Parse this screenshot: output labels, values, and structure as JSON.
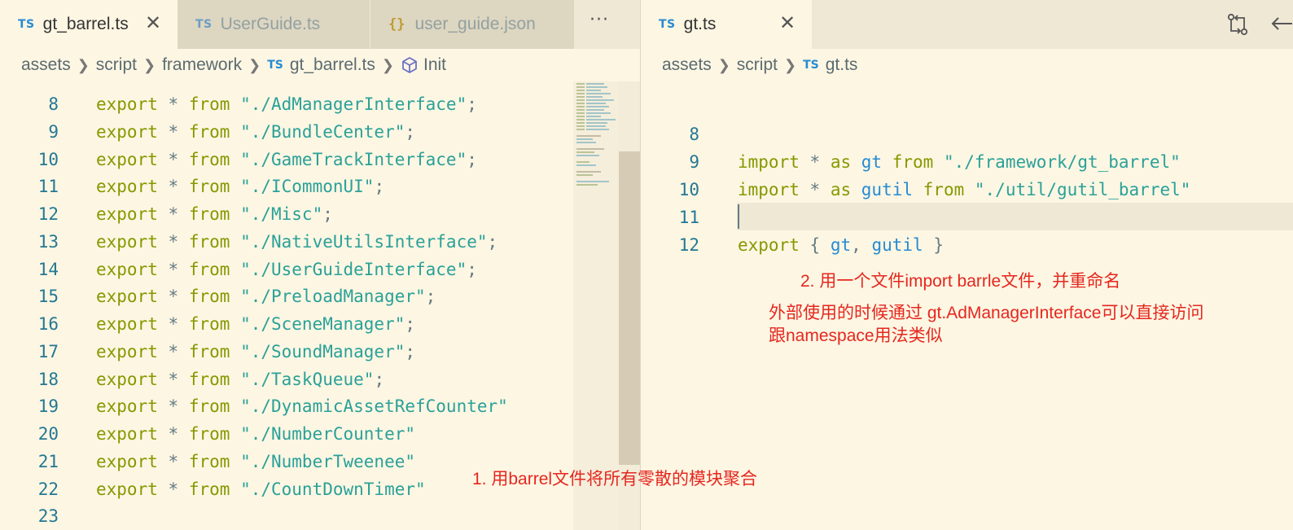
{
  "colors": {
    "background": "#fdf6e3",
    "tabbar": "#eee8d5",
    "keyword": "#859900",
    "string": "#2aa198",
    "identifier": "#268bd2",
    "line_number": "#237893",
    "annotation": "#e5271f"
  },
  "left_editor": {
    "tabs": [
      {
        "badge": "TS",
        "label": "gt_barrel.ts",
        "active": true,
        "close_icon": "close-icon"
      },
      {
        "badge": "TS",
        "label": "UserGuide.ts",
        "active": false
      },
      {
        "badge": "{}",
        "label": "user_guide.json",
        "active": false
      }
    ],
    "more_label": "···",
    "breadcrumb": {
      "parts": [
        "assets",
        "script",
        "framework",
        "gt_barrel.ts",
        "Init"
      ],
      "file_badge": "TS",
      "symbol_icon": "cube-icon"
    },
    "lines": [
      {
        "num": "8",
        "kw": "export",
        "star": "*",
        "from": "from",
        "str": "\"./AdManagerInterface\"",
        "end": ";"
      },
      {
        "num": "9",
        "kw": "export",
        "star": "*",
        "from": "from",
        "str": "\"./BundleCenter\"",
        "end": ";"
      },
      {
        "num": "10",
        "kw": "export",
        "star": "*",
        "from": "from",
        "str": "\"./GameTrackInterface\"",
        "end": ";"
      },
      {
        "num": "11",
        "kw": "export",
        "star": "*",
        "from": "from",
        "str": "\"./ICommonUI\"",
        "end": ";"
      },
      {
        "num": "12",
        "kw": "export",
        "star": "*",
        "from": "from",
        "str": "\"./Misc\"",
        "end": ";"
      },
      {
        "num": "13",
        "kw": "export",
        "star": "*",
        "from": "from",
        "str": "\"./NativeUtilsInterface\"",
        "end": ";"
      },
      {
        "num": "14",
        "kw": "export",
        "star": "*",
        "from": "from",
        "str": "\"./UserGuideInterface\"",
        "end": ";"
      },
      {
        "num": "15",
        "kw": "export",
        "star": "*",
        "from": "from",
        "str": "\"./PreloadManager\"",
        "end": ";"
      },
      {
        "num": "16",
        "kw": "export",
        "star": "*",
        "from": "from",
        "str": "\"./SceneManager\"",
        "end": ";"
      },
      {
        "num": "17",
        "kw": "export",
        "star": "*",
        "from": "from",
        "str": "\"./SoundManager\"",
        "end": ";"
      },
      {
        "num": "18",
        "kw": "export",
        "star": "*",
        "from": "from",
        "str": "\"./TaskQueue\"",
        "end": ";"
      },
      {
        "num": "19",
        "kw": "export",
        "star": "*",
        "from": "from",
        "str": "\"./DynamicAssetRefCounter\"",
        "end": ""
      },
      {
        "num": "20",
        "kw": "export",
        "star": "*",
        "from": "from",
        "str": "\"./NumberCounter\"",
        "end": ""
      },
      {
        "num": "21",
        "kw": "export",
        "star": "*",
        "from": "from",
        "str": "\"./NumberTweenee\"",
        "end": ""
      },
      {
        "num": "22",
        "kw": "export",
        "star": "*",
        "from": "from",
        "str": "\"./CountDownTimer\"",
        "end": ""
      },
      {
        "num": "23",
        "kw": "",
        "star": "",
        "from": "",
        "str": "",
        "end": ""
      }
    ]
  },
  "right_editor": {
    "tab": {
      "badge": "TS",
      "label": "gt.ts",
      "active": true,
      "close_icon": "close-icon"
    },
    "actions": [
      "compare-changes-icon",
      "back-arrow-icon"
    ],
    "breadcrumb": {
      "parts": [
        "assets",
        "script",
        "gt.ts"
      ],
      "file_badge": "TS"
    },
    "lines": {
      "l8": {
        "num": "8",
        "import": "import",
        "star": "*",
        "as": "as",
        "name": "gt",
        "from": "from",
        "str": "\"./framework/gt_barrel\""
      },
      "l9": {
        "num": "9",
        "import": "import",
        "star": "*",
        "as": "as",
        "name": "gutil",
        "from": "from",
        "str": "\"./util/gutil_barrel\""
      },
      "l10": {
        "num": "10"
      },
      "l11": {
        "num": "11",
        "kw": "export",
        "open": "{",
        "a": "gt",
        "comma": ",",
        "b": "gutil",
        "close": "}"
      },
      "l12": {
        "num": "12"
      }
    }
  },
  "annotations": {
    "note1": "1. 用barrel文件将所有零散的模块聚合",
    "note2": "2. 用一个文件import barrle文件，并重命名",
    "note3_line1": "外部使用的时候通过 gt.AdManagerInterface可以直接访问",
    "note3_line2": "跟namespace用法类似"
  }
}
